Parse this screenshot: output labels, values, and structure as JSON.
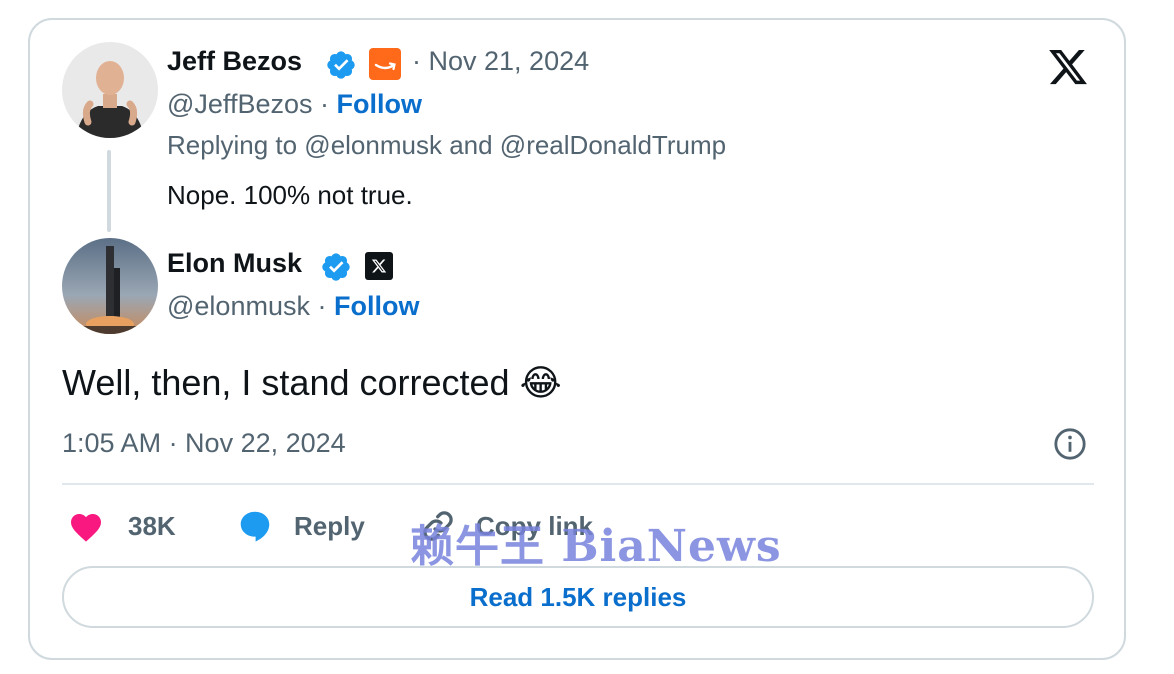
{
  "reply_tweet": {
    "author_name": "Jeff Bezos",
    "date": "Nov 21, 2024",
    "handle": "@JeffBezos",
    "follow_label": "Follow",
    "replying_to": "Replying to @elonmusk and @realDonaldTrump",
    "text": "Nope. 100% not true."
  },
  "main_tweet": {
    "author_name": "Elon Musk",
    "handle": "@elonmusk",
    "follow_label": "Follow",
    "text": "Well, then, I stand corrected",
    "emoji": "😂",
    "timestamp": "1:05 AM · Nov 22, 2024"
  },
  "actions": {
    "likes_count": "38K",
    "reply_label": "Reply",
    "copy_link_label": "Copy link"
  },
  "read_replies_label": "Read 1.5K replies",
  "watermark": "赖牛王 BiaNews",
  "icons": {
    "brand_logo": "x-logo-icon",
    "verified": "verified-badge-icon",
    "affiliation_amazon": "amazon-icon",
    "affiliation_x": "x-affiliation-icon",
    "info": "info-icon",
    "like": "heart-icon",
    "reply": "reply-bubble-icon",
    "copy_link": "link-icon"
  },
  "colors": {
    "follow_link": "#0a6ecc",
    "verified_blue": "#1d9bf0",
    "heart_pink": "#f91880",
    "muted_text": "#536471",
    "border": "#cfd9de"
  }
}
